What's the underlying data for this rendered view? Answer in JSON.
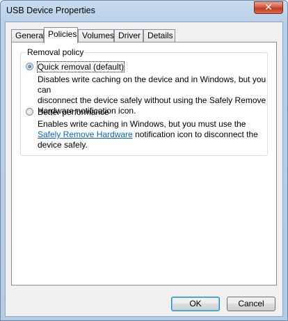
{
  "window": {
    "title": "USB Device Properties",
    "close_glyph": "✕"
  },
  "tabs": [
    {
      "label": "General",
      "active": false
    },
    {
      "label": "Policies",
      "active": true
    },
    {
      "label": "Volumes",
      "active": false
    },
    {
      "label": "Driver",
      "active": false
    },
    {
      "label": "Details",
      "active": false
    }
  ],
  "removal_policy": {
    "group_label": "Removal policy",
    "options": [
      {
        "label": "Quick removal (default)",
        "selected": true,
        "description_lines": [
          "Disables write caching on the device and in Windows, but you can",
          "disconnect the device safely without using the Safely Remove",
          "Hardware notification icon."
        ]
      },
      {
        "label": "Better performance",
        "selected": false,
        "description_line1": "Enables write caching in Windows, but you must use the",
        "link_text": "Safely Remove Hardware",
        "after_link": " notification icon to disconnect the",
        "description_line3": "device safely."
      }
    ]
  },
  "buttons": {
    "ok": "OK",
    "cancel": "Cancel"
  },
  "colors": {
    "link": "#0066cc",
    "title_bar": "#b9d0e8",
    "close_button": "#c33a22"
  }
}
